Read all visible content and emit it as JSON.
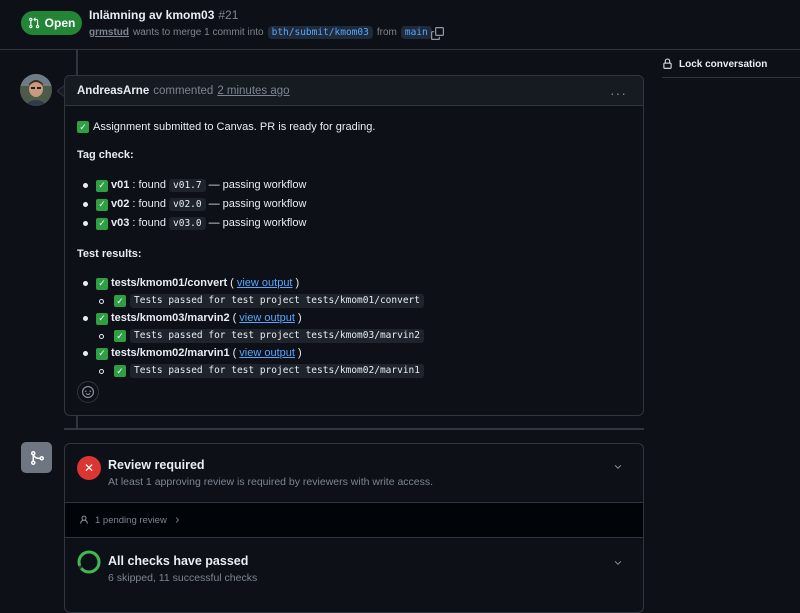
{
  "header": {
    "state_label": "Open",
    "title": "Inlämning av kmom03",
    "number": "#21",
    "author": "grmstud",
    "merge_text": "wants to merge 1 commit into",
    "base_branch": "bth/submit/kmom03",
    "from_text": "from",
    "head_branch": "main"
  },
  "sidebar": {
    "lock_label": "Lock conversation"
  },
  "comment": {
    "author": "AndreasArne",
    "action": "commented",
    "time": "2 minutes ago",
    "menu": "···",
    "intro": "Assignment submitted to Canvas. PR is ready for grading.",
    "tag_heading": "Tag check:",
    "tags": [
      {
        "name": "v01",
        "found": ": found",
        "version": "v01.7",
        "result": "— passing workflow"
      },
      {
        "name": "v02",
        "found": ": found",
        "version": "v02.0",
        "result": "— passing workflow"
      },
      {
        "name": "v03",
        "found": ": found",
        "version": "v03.0",
        "result": "— passing workflow"
      }
    ],
    "test_heading": "Test results:",
    "tests": [
      {
        "name": "tests/kmom01/convert",
        "link": "view output",
        "detail": "Tests passed for test project tests/kmom01/convert"
      },
      {
        "name": "tests/kmom03/marvin2",
        "link": "view output",
        "detail": "Tests passed for test project tests/kmom03/marvin2"
      },
      {
        "name": "tests/kmom02/marvin1",
        "link": "view output",
        "detail": "Tests passed for test project tests/kmom02/marvin1"
      }
    ]
  },
  "merge": {
    "review_title": "Review required",
    "review_sub": "At least 1 approving review is required by reviewers with write access.",
    "pending": "1 pending review",
    "checks_title": "All checks have passed",
    "checks_sub": "6 skipped, 11 successful checks"
  }
}
